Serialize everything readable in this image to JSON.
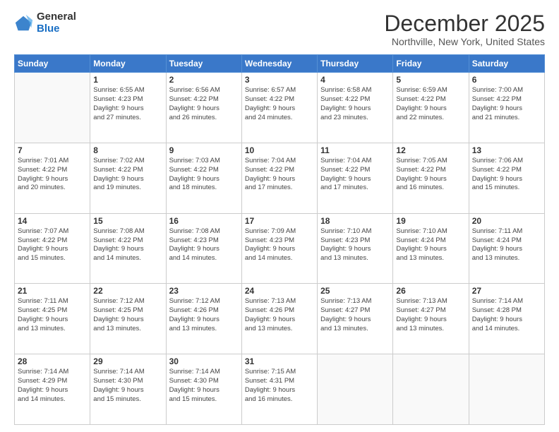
{
  "logo": {
    "general": "General",
    "blue": "Blue"
  },
  "title": "December 2025",
  "subtitle": "Northville, New York, United States",
  "days_of_week": [
    "Sunday",
    "Monday",
    "Tuesday",
    "Wednesday",
    "Thursday",
    "Friday",
    "Saturday"
  ],
  "weeks": [
    [
      {
        "day": "",
        "info": ""
      },
      {
        "day": "1",
        "info": "Sunrise: 6:55 AM\nSunset: 4:23 PM\nDaylight: 9 hours\nand 27 minutes."
      },
      {
        "day": "2",
        "info": "Sunrise: 6:56 AM\nSunset: 4:22 PM\nDaylight: 9 hours\nand 26 minutes."
      },
      {
        "day": "3",
        "info": "Sunrise: 6:57 AM\nSunset: 4:22 PM\nDaylight: 9 hours\nand 24 minutes."
      },
      {
        "day": "4",
        "info": "Sunrise: 6:58 AM\nSunset: 4:22 PM\nDaylight: 9 hours\nand 23 minutes."
      },
      {
        "day": "5",
        "info": "Sunrise: 6:59 AM\nSunset: 4:22 PM\nDaylight: 9 hours\nand 22 minutes."
      },
      {
        "day": "6",
        "info": "Sunrise: 7:00 AM\nSunset: 4:22 PM\nDaylight: 9 hours\nand 21 minutes."
      }
    ],
    [
      {
        "day": "7",
        "info": "Sunrise: 7:01 AM\nSunset: 4:22 PM\nDaylight: 9 hours\nand 20 minutes."
      },
      {
        "day": "8",
        "info": "Sunrise: 7:02 AM\nSunset: 4:22 PM\nDaylight: 9 hours\nand 19 minutes."
      },
      {
        "day": "9",
        "info": "Sunrise: 7:03 AM\nSunset: 4:22 PM\nDaylight: 9 hours\nand 18 minutes."
      },
      {
        "day": "10",
        "info": "Sunrise: 7:04 AM\nSunset: 4:22 PM\nDaylight: 9 hours\nand 17 minutes."
      },
      {
        "day": "11",
        "info": "Sunrise: 7:04 AM\nSunset: 4:22 PM\nDaylight: 9 hours\nand 17 minutes."
      },
      {
        "day": "12",
        "info": "Sunrise: 7:05 AM\nSunset: 4:22 PM\nDaylight: 9 hours\nand 16 minutes."
      },
      {
        "day": "13",
        "info": "Sunrise: 7:06 AM\nSunset: 4:22 PM\nDaylight: 9 hours\nand 15 minutes."
      }
    ],
    [
      {
        "day": "14",
        "info": "Sunrise: 7:07 AM\nSunset: 4:22 PM\nDaylight: 9 hours\nand 15 minutes."
      },
      {
        "day": "15",
        "info": "Sunrise: 7:08 AM\nSunset: 4:22 PM\nDaylight: 9 hours\nand 14 minutes."
      },
      {
        "day": "16",
        "info": "Sunrise: 7:08 AM\nSunset: 4:23 PM\nDaylight: 9 hours\nand 14 minutes."
      },
      {
        "day": "17",
        "info": "Sunrise: 7:09 AM\nSunset: 4:23 PM\nDaylight: 9 hours\nand 14 minutes."
      },
      {
        "day": "18",
        "info": "Sunrise: 7:10 AM\nSunset: 4:23 PM\nDaylight: 9 hours\nand 13 minutes."
      },
      {
        "day": "19",
        "info": "Sunrise: 7:10 AM\nSunset: 4:24 PM\nDaylight: 9 hours\nand 13 minutes."
      },
      {
        "day": "20",
        "info": "Sunrise: 7:11 AM\nSunset: 4:24 PM\nDaylight: 9 hours\nand 13 minutes."
      }
    ],
    [
      {
        "day": "21",
        "info": "Sunrise: 7:11 AM\nSunset: 4:25 PM\nDaylight: 9 hours\nand 13 minutes."
      },
      {
        "day": "22",
        "info": "Sunrise: 7:12 AM\nSunset: 4:25 PM\nDaylight: 9 hours\nand 13 minutes."
      },
      {
        "day": "23",
        "info": "Sunrise: 7:12 AM\nSunset: 4:26 PM\nDaylight: 9 hours\nand 13 minutes."
      },
      {
        "day": "24",
        "info": "Sunrise: 7:13 AM\nSunset: 4:26 PM\nDaylight: 9 hours\nand 13 minutes."
      },
      {
        "day": "25",
        "info": "Sunrise: 7:13 AM\nSunset: 4:27 PM\nDaylight: 9 hours\nand 13 minutes."
      },
      {
        "day": "26",
        "info": "Sunrise: 7:13 AM\nSunset: 4:27 PM\nDaylight: 9 hours\nand 13 minutes."
      },
      {
        "day": "27",
        "info": "Sunrise: 7:14 AM\nSunset: 4:28 PM\nDaylight: 9 hours\nand 14 minutes."
      }
    ],
    [
      {
        "day": "28",
        "info": "Sunrise: 7:14 AM\nSunset: 4:29 PM\nDaylight: 9 hours\nand 14 minutes."
      },
      {
        "day": "29",
        "info": "Sunrise: 7:14 AM\nSunset: 4:30 PM\nDaylight: 9 hours\nand 15 minutes."
      },
      {
        "day": "30",
        "info": "Sunrise: 7:14 AM\nSunset: 4:30 PM\nDaylight: 9 hours\nand 15 minutes."
      },
      {
        "day": "31",
        "info": "Sunrise: 7:15 AM\nSunset: 4:31 PM\nDaylight: 9 hours\nand 16 minutes."
      },
      {
        "day": "",
        "info": ""
      },
      {
        "day": "",
        "info": ""
      },
      {
        "day": "",
        "info": ""
      }
    ]
  ]
}
